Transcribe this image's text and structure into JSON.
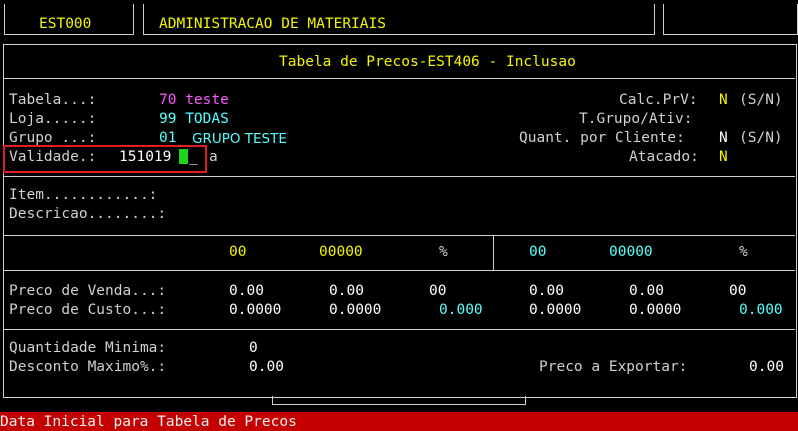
{
  "header": {
    "code": "EST000",
    "title": "ADMINISTRACAO DE MATERIAIS"
  },
  "screen": {
    "title": "Tabela de Precos-EST406 - Inclusao"
  },
  "form": {
    "tabela_label": "Tabela...:",
    "tabela_value": "70 teste",
    "loja_label": "Loja.....:",
    "loja_value": "99 TODAS",
    "grupo_label": "Grupo ...:",
    "grupo_code": "01",
    "grupo_name": "GRUPO TESTE",
    "validade_label": "Validade.:",
    "validade_value": "151019",
    "validade_suffix": "a",
    "calc_label": "Calc.PrV:",
    "calc_value": "N",
    "calc_options": "(S/N)",
    "tgrupo_label": "T.Grupo/Ativ:",
    "quant_label": "Quant. por Cliente:",
    "quant_value": "N",
    "quant_options": "(S/N)",
    "atacado_label": "Atacado:",
    "atacado_value": "N"
  },
  "item": {
    "item_label": "Item............:",
    "descricao_label": "Descricao........:"
  },
  "prices": {
    "left_header": [
      "00",
      "00000",
      "%"
    ],
    "right_header": [
      "00",
      "00000",
      "%"
    ],
    "venda_label": "Preco de Venda...:",
    "venda_left": [
      "0.00",
      "0.00",
      "00"
    ],
    "venda_right": [
      "0.00",
      "0.00",
      "00"
    ],
    "custo_label": "Preco de Custo...:",
    "custo_left": [
      "0.0000",
      "0.0000",
      "0.000"
    ],
    "custo_right": [
      "0.0000",
      "0.0000",
      "0.000"
    ]
  },
  "bottom": {
    "qtd_label": "Quantidade Minima:",
    "qtd_value": "0",
    "desc_label": "Desconto Maximo%.:",
    "desc_value": "0.00",
    "exportar_label": "Preco a Exportar:",
    "exportar_value": "0.00"
  },
  "status": {
    "message": "Data Inicial para Tabela de Precos"
  },
  "colors": {
    "field_yellow": "#f5f500",
    "magenta": "#ff55ff",
    "cyan": "#55ffff",
    "status_red": "#c40000",
    "cursor_green": "#1ed41e"
  }
}
